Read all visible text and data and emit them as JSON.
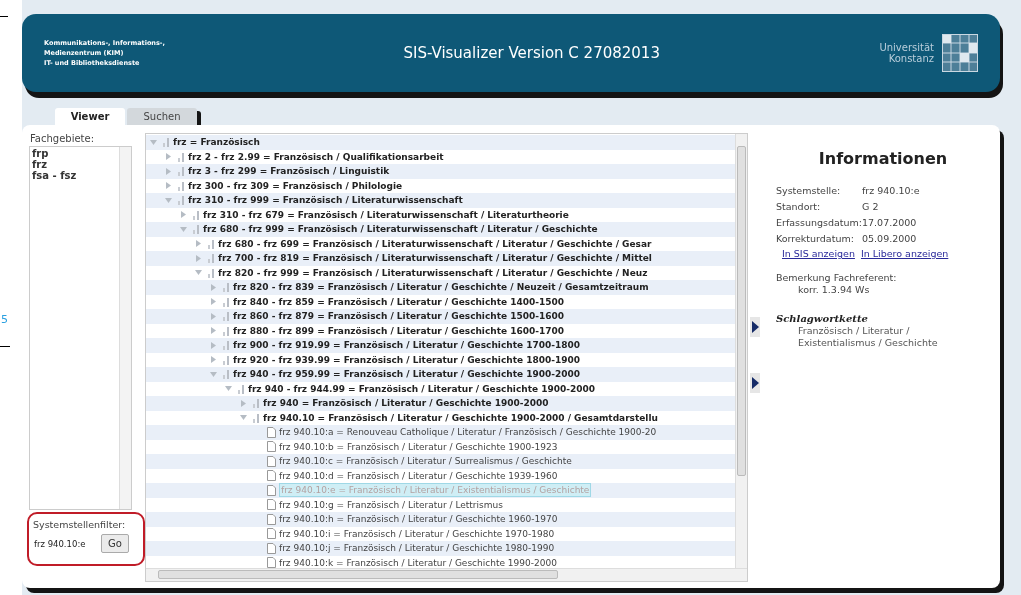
{
  "edge_fragment": "5",
  "header": {
    "org_lines": [
      "Kommunikations-, Informations-,",
      "Medienzentrum (KIM)",
      "IT- und Bibliotheksdienste"
    ],
    "title": "SIS-Visualizer Version C 27082013",
    "university_lines": [
      "Universität",
      "Konstanz"
    ]
  },
  "tabs": [
    {
      "label": "Viewer",
      "selected": true
    },
    {
      "label": "Suchen",
      "selected": false
    }
  ],
  "subject_areas": {
    "label": "Fachgebiete:",
    "items": [
      {
        "label": "frp",
        "selected": false
      },
      {
        "label": "frz",
        "selected": false
      },
      {
        "label": "fsa - fsz",
        "selected": false
      }
    ]
  },
  "filter": {
    "label": "Systemstellenfilter:",
    "value": "frz 940.10:e",
    "button": "Go"
  },
  "tree": [
    {
      "label": "frz = Französisch",
      "kind": "folder",
      "expanded": true,
      "selected": false,
      "children": [
        {
          "label": "frz 2 - frz 2.99 = Französisch / Qualifikationsarbeit",
          "kind": "folder",
          "expanded": false,
          "selected": false
        },
        {
          "label": "frz 3 - frz 299 = Französisch / Linguistik",
          "kind": "folder",
          "expanded": false,
          "selected": false
        },
        {
          "label": "frz 300 - frz 309 = Französisch / Philologie",
          "kind": "folder",
          "expanded": false,
          "selected": false
        },
        {
          "label": "frz 310 - frz 999 = Französisch / Literaturwissenschaft",
          "kind": "folder",
          "expanded": true,
          "selected": false,
          "children": [
            {
              "label": "frz 310 - frz 679 = Französisch / Literaturwissenschaft / Literaturtheorie",
              "kind": "folder",
              "expanded": false,
              "selected": false
            },
            {
              "label": "frz 680 - frz 999 = Französisch / Literaturwissenschaft / Literatur / Geschichte",
              "kind": "folder",
              "expanded": true,
              "selected": false,
              "children": [
                {
                  "label": "frz 680 - frz 699 = Französisch / Literaturwissenschaft / Literatur / Geschichte / Gesar",
                  "kind": "folder",
                  "expanded": false,
                  "selected": false
                },
                {
                  "label": "frz 700 - frz 819 = Französisch / Literaturwissenschaft / Literatur / Geschichte / Mittel",
                  "kind": "folder",
                  "expanded": false,
                  "selected": false
                },
                {
                  "label": "frz 820 - frz 999 = Französisch / Literaturwissenschaft / Literatur / Geschichte / Neuz",
                  "kind": "folder",
                  "expanded": true,
                  "selected": false,
                  "children": [
                    {
                      "label": "frz 820 - frz 839 = Französisch / Literatur / Geschichte / Neuzeit / Gesamtzeitraum",
                      "kind": "folder",
                      "expanded": false,
                      "selected": false
                    },
                    {
                      "label": "frz 840 - frz 859 = Französisch / Literatur / Geschichte 1400-1500",
                      "kind": "folder",
                      "expanded": false,
                      "selected": false
                    },
                    {
                      "label": "frz 860 - frz 879 = Französisch / Literatur / Geschichte 1500-1600",
                      "kind": "folder",
                      "expanded": false,
                      "selected": false
                    },
                    {
                      "label": "frz 880 - frz 899 = Französisch / Literatur / Geschichte 1600-1700",
                      "kind": "folder",
                      "expanded": false,
                      "selected": false
                    },
                    {
                      "label": "frz 900 - frz 919.99 = Französisch / Literatur / Geschichte 1700-1800",
                      "kind": "folder",
                      "expanded": false,
                      "selected": false
                    },
                    {
                      "label": "frz 920 - frz 939.99 = Französisch / Literatur / Geschichte 1800-1900",
                      "kind": "folder",
                      "expanded": false,
                      "selected": false
                    },
                    {
                      "label": "frz 940 - frz 959.99 = Französisch / Literatur / Geschichte 1900-2000",
                      "kind": "folder",
                      "expanded": true,
                      "selected": false,
                      "children": [
                        {
                          "label": "frz 940 - frz 944.99 = Französisch / Literatur / Geschichte 1900-2000",
                          "kind": "folder",
                          "expanded": true,
                          "selected": false,
                          "children": [
                            {
                              "label": "frz 940 = Französisch / Literatur / Geschichte 1900-2000",
                              "kind": "folder",
                              "expanded": false,
                              "selected": false
                            },
                            {
                              "label": "frz 940.10 = Französisch / Literatur / Geschichte 1900-2000 / Gesamtdarstellu",
                              "kind": "folder",
                              "expanded": true,
                              "selected": false,
                              "children": [
                                {
                                  "label": "frz 940.10:a = Renouveau Catholique / Literatur / Französisch / Geschichte 1900-20",
                                  "kind": "leaf",
                                  "selected": false
                                },
                                {
                                  "label": "frz 940.10:b = Französisch / Literatur / Geschichte 1900-1923",
                                  "kind": "leaf",
                                  "selected": false
                                },
                                {
                                  "label": "frz 940.10:c = Französisch / Literatur / Surrealismus / Geschichte",
                                  "kind": "leaf",
                                  "selected": false
                                },
                                {
                                  "label": "frz 940.10:d = Französisch / Literatur / Geschichte 1939-1960",
                                  "kind": "leaf",
                                  "selected": false
                                },
                                {
                                  "label": "frz 940.10:e = Französisch / Literatur / Existentialismus / Geschichte",
                                  "kind": "leaf",
                                  "selected": true
                                },
                                {
                                  "label": "frz 940.10:g = Französisch / Literatur / Lettrismus",
                                  "kind": "leaf",
                                  "selected": false
                                },
                                {
                                  "label": "frz 940.10:h = Französisch / Literatur / Geschichte 1960-1970",
                                  "kind": "leaf",
                                  "selected": false
                                },
                                {
                                  "label": "frz 940.10:i = Französisch / Literatur / Geschichte 1970-1980",
                                  "kind": "leaf",
                                  "selected": false
                                },
                                {
                                  "label": "frz 940.10:j = Französisch / Literatur / Geschichte 1980-1990",
                                  "kind": "leaf",
                                  "selected": false
                                },
                                {
                                  "label": "frz 940.10:k = Französisch / Literatur / Geschichte 1990-2000",
                                  "kind": "leaf",
                                  "selected": false
                                }
                              ]
                            }
                          ]
                        }
                      ]
                    }
                  ]
                }
              ]
            }
          ]
        }
      ]
    }
  ],
  "info": {
    "title": "Informationen",
    "fields": [
      {
        "label": "Systemstelle:",
        "value": "frz 940.10:e"
      },
      {
        "label": "Standort:",
        "value": "G 2"
      },
      {
        "label": "Erfassungsdatum:",
        "value": "17.07.2000"
      },
      {
        "label": "Korrekturdatum:",
        "value": "05.09.2000"
      }
    ],
    "links": [
      "In SIS anzeigen",
      "In Libero anzeigen"
    ],
    "remark": {
      "label": "Bemerkung Fachreferent:",
      "value": "korr. 1.3.94 Ws"
    },
    "keyword_chain": {
      "label": "Schlagwortkette",
      "value": "Französisch / Literatur / Existentialismus / Geschichte"
    }
  }
}
